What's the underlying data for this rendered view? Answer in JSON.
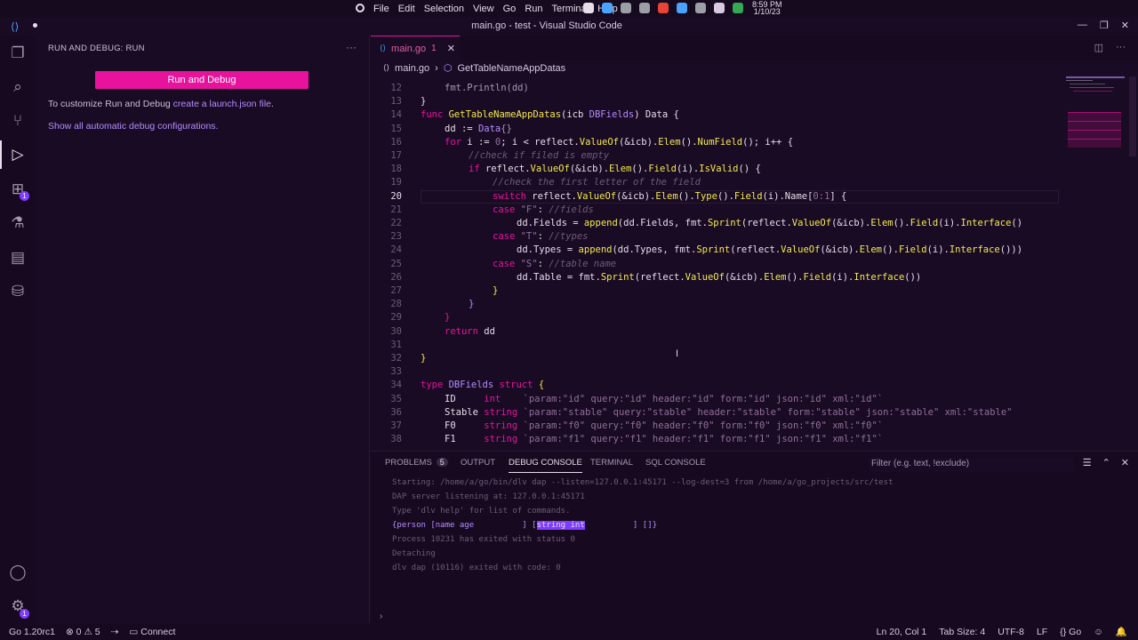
{
  "system_bar": {
    "menu": [
      "File",
      "Edit",
      "Selection",
      "View",
      "Go",
      "Run",
      "Terminal",
      "Help"
    ],
    "tray_colors": [
      "#e6dcea",
      "#4aa3ff",
      "#9aa0a6",
      "#9aa0a6",
      "#ea4335",
      "#4aa3ff",
      "#9aa0a6",
      "#d8c8e0",
      "#34a853"
    ],
    "clock_time": "8:59 PM",
    "clock_date": "1/10/23"
  },
  "window": {
    "title": "main.go - test - Visual Studio Code"
  },
  "activity_bar": {
    "items": [
      "explorer-icon",
      "search-icon",
      "source-control-icon",
      "run-debug-icon",
      "extensions-icon",
      "testing-icon",
      "remote-icon",
      "database-icon"
    ],
    "extensions_badge": "1",
    "manage_badge": "1"
  },
  "sidebar": {
    "title": "RUN AND DEBUG: RUN",
    "run_button": "Run and Debug",
    "customize_text": "To customize Run and Debug ",
    "customize_link": "create a launch.json file",
    "customize_tail": ".",
    "show_all_link": "Show all automatic debug configurations."
  },
  "editor": {
    "tab_label": "main.go",
    "tab_errors": "1",
    "breadcrumb_file": "main.go",
    "breadcrumb_symbol": "GetTableNameAppDatas",
    "current_line": 20,
    "lines": [
      {
        "n": "12",
        "indent": 1,
        "tokens": [
          [
            "fmt.Println(dd)",
            "op"
          ]
        ]
      },
      {
        "n": "13",
        "indent": 0,
        "tokens": [
          [
            "}",
            ""
          ]
        ]
      },
      {
        "n": "14",
        "indent": 0,
        "tokens": [
          [
            "func ",
            "kw"
          ],
          [
            "GetTableNameAppDatas",
            "fn"
          ],
          [
            "(icb ",
            ""
          ],
          [
            "DBFields",
            "ty"
          ],
          [
            ") Data {",
            ""
          ]
        ]
      },
      {
        "n": "15",
        "indent": 1,
        "tokens": [
          [
            "dd := ",
            ""
          ],
          [
            "Data",
            "ty"
          ],
          [
            "{}",
            "op"
          ]
        ]
      },
      {
        "n": "16",
        "indent": 1,
        "tokens": [
          [
            "for ",
            "kw"
          ],
          [
            "i := ",
            ""
          ],
          [
            "0",
            "nu"
          ],
          [
            "; i < reflect.",
            ""
          ],
          [
            "ValueOf",
            "fn"
          ],
          [
            "(&icb).",
            ""
          ],
          [
            "Elem",
            "fn"
          ],
          [
            "().",
            ""
          ],
          [
            "NumField",
            "fn"
          ],
          [
            "(); i++ {",
            ""
          ]
        ]
      },
      {
        "n": "17",
        "indent": 2,
        "tokens": [
          [
            "//check if filed is empty",
            "cm"
          ]
        ]
      },
      {
        "n": "18",
        "indent": 2,
        "tokens": [
          [
            "if ",
            "kw"
          ],
          [
            "reflect.",
            ""
          ],
          [
            "ValueOf",
            "fn"
          ],
          [
            "(&icb).",
            ""
          ],
          [
            "Elem",
            "fn"
          ],
          [
            "().",
            ""
          ],
          [
            "Field",
            "fn"
          ],
          [
            "(i).",
            ""
          ],
          [
            "IsValid",
            "fn"
          ],
          [
            "() {",
            ""
          ]
        ]
      },
      {
        "n": "19",
        "indent": 3,
        "tokens": [
          [
            "//check the first letter of the field",
            "cm"
          ]
        ]
      },
      {
        "n": "20",
        "indent": 3,
        "tokens": [
          [
            "switch ",
            "kw"
          ],
          [
            "reflect.",
            ""
          ],
          [
            "ValueOf",
            "fn"
          ],
          [
            "(&icb).",
            ""
          ],
          [
            "Elem",
            "fn"
          ],
          [
            "().",
            ""
          ],
          [
            "Type",
            "fn"
          ],
          [
            "().",
            ""
          ],
          [
            "Field",
            "fn"
          ],
          [
            "(i).Name[",
            ""
          ],
          [
            "0:1",
            "nu"
          ],
          [
            "] {",
            ""
          ]
        ]
      },
      {
        "n": "21",
        "indent": 3,
        "tokens": [
          [
            "case ",
            "kw"
          ],
          [
            "\"F\"",
            "st"
          ],
          [
            ": ",
            ""
          ],
          [
            "//fields",
            "cm"
          ]
        ]
      },
      {
        "n": "22",
        "indent": 4,
        "tokens": [
          [
            "dd.Fields = ",
            ""
          ],
          [
            "append",
            "fn"
          ],
          [
            "(dd.Fields, fmt.",
            ""
          ],
          [
            "Sprint",
            "fn"
          ],
          [
            "(reflect.",
            ""
          ],
          [
            "ValueOf",
            "fn"
          ],
          [
            "(&icb).",
            ""
          ],
          [
            "Elem",
            "fn"
          ],
          [
            "().",
            ""
          ],
          [
            "Field",
            "fn"
          ],
          [
            "(i).",
            ""
          ],
          [
            "Interface",
            "fn"
          ],
          [
            "()",
            ""
          ]
        ]
      },
      {
        "n": "23",
        "indent": 3,
        "tokens": [
          [
            "case ",
            "kw"
          ],
          [
            "\"T\"",
            "st"
          ],
          [
            ": ",
            ""
          ],
          [
            "//types",
            "cm"
          ]
        ]
      },
      {
        "n": "24",
        "indent": 4,
        "tokens": [
          [
            "dd.Types = ",
            ""
          ],
          [
            "append",
            "fn"
          ],
          [
            "(dd.Types, fmt.",
            ""
          ],
          [
            "Sprint",
            "fn"
          ],
          [
            "(reflect.",
            ""
          ],
          [
            "ValueOf",
            "fn"
          ],
          [
            "(&icb).",
            ""
          ],
          [
            "Elem",
            "fn"
          ],
          [
            "().",
            ""
          ],
          [
            "Field",
            "fn"
          ],
          [
            "(i).",
            ""
          ],
          [
            "Interface",
            "fn"
          ],
          [
            "()))",
            ""
          ]
        ]
      },
      {
        "n": "25",
        "indent": 3,
        "tokens": [
          [
            "case ",
            "kw"
          ],
          [
            "\"S\"",
            "st"
          ],
          [
            ": ",
            ""
          ],
          [
            "//table name",
            "cm"
          ]
        ]
      },
      {
        "n": "26",
        "indent": 4,
        "tokens": [
          [
            "dd.Table = fmt.",
            ""
          ],
          [
            "Sprint",
            "fn"
          ],
          [
            "(reflect.",
            ""
          ],
          [
            "ValueOf",
            "fn"
          ],
          [
            "(&icb).",
            ""
          ],
          [
            "Elem",
            "fn"
          ],
          [
            "().",
            ""
          ],
          [
            "Field",
            "fn"
          ],
          [
            "(i).",
            ""
          ],
          [
            "Interface",
            "fn"
          ],
          [
            "())",
            ""
          ]
        ]
      },
      {
        "n": "27",
        "indent": 3,
        "tokens": [
          [
            "}",
            "fn"
          ]
        ]
      },
      {
        "n": "28",
        "indent": 2,
        "tokens": [
          [
            "}",
            "ty"
          ]
        ]
      },
      {
        "n": "29",
        "indent": 1,
        "tokens": [
          [
            "}",
            "kw"
          ]
        ]
      },
      {
        "n": "30",
        "indent": 1,
        "tokens": [
          [
            "return ",
            "kw"
          ],
          [
            "dd",
            ""
          ]
        ]
      },
      {
        "n": "31",
        "indent": 0,
        "tokens": []
      },
      {
        "n": "32",
        "indent": 0,
        "tokens": [
          [
            "}",
            "fn"
          ]
        ]
      },
      {
        "n": "33",
        "indent": 0,
        "tokens": []
      },
      {
        "n": "34",
        "indent": 0,
        "tokens": [
          [
            "type ",
            "kw"
          ],
          [
            "DBFields ",
            "ty"
          ],
          [
            "struct ",
            "kw"
          ],
          [
            "{",
            "fn"
          ]
        ]
      },
      {
        "n": "35",
        "indent": 1,
        "tokens": [
          [
            "ID     ",
            ""
          ],
          [
            "int    ",
            "kw"
          ],
          [
            "`param:\"id\" query:\"id\" header:\"id\" form:\"id\" json:\"id\" xml:\"id\"`",
            "st"
          ]
        ]
      },
      {
        "n": "36",
        "indent": 1,
        "tokens": [
          [
            "Stable ",
            ""
          ],
          [
            "string ",
            "kw"
          ],
          [
            "`param:\"stable\" query:\"stable\" header:\"stable\" form:\"stable\" json:\"stable\" xml:\"stable\"",
            "st"
          ]
        ]
      },
      {
        "n": "37",
        "indent": 1,
        "tokens": [
          [
            "F0     ",
            ""
          ],
          [
            "string ",
            "kw"
          ],
          [
            "`param:\"f0\" query:\"f0\" header:\"f0\" form:\"f0\" json:\"f0\" xml:\"f0\"`",
            "st"
          ]
        ]
      },
      {
        "n": "38",
        "indent": 1,
        "tokens": [
          [
            "F1     ",
            ""
          ],
          [
            "string ",
            "kw"
          ],
          [
            "`param:\"f1\" query:\"f1\" header:\"f1\" form:\"f1\" json:\"f1\" xml:\"f1\"`",
            "st"
          ]
        ]
      }
    ]
  },
  "panel": {
    "tabs": [
      "PROBLEMS",
      "OUTPUT",
      "DEBUG CONSOLE",
      "TERMINAL",
      "SQL CONSOLE"
    ],
    "problems_count": "5",
    "active_tab": "DEBUG CONSOLE",
    "filter_placeholder": "Filter (e.g. text, !exclude)",
    "output_lines": [
      "Starting: /home/a/go/bin/dlv dap --listen=127.0.0.1:45171 --log-dest=3 from /home/a/go_projects/src/test",
      "DAP server listening at: 127.0.0.1:45171",
      "Type 'dlv help' for list of commands."
    ],
    "result_pre": "{person [name age          ] [",
    "result_hl": "string int",
    "result_post": "          ] []}",
    "trailing_lines": [
      "Process 10231 has exited with status 0",
      "Detaching",
      "dlv dap (10116) exited with code: 0"
    ]
  },
  "status_bar": {
    "go_version": "Go 1.20rc1",
    "errors": "0",
    "warnings": "5",
    "connect": "Connect",
    "position": "Ln 20, Col 1",
    "tab_size": "Tab Size: 4",
    "encoding": "UTF-8",
    "eol": "LF",
    "language": "Go"
  }
}
